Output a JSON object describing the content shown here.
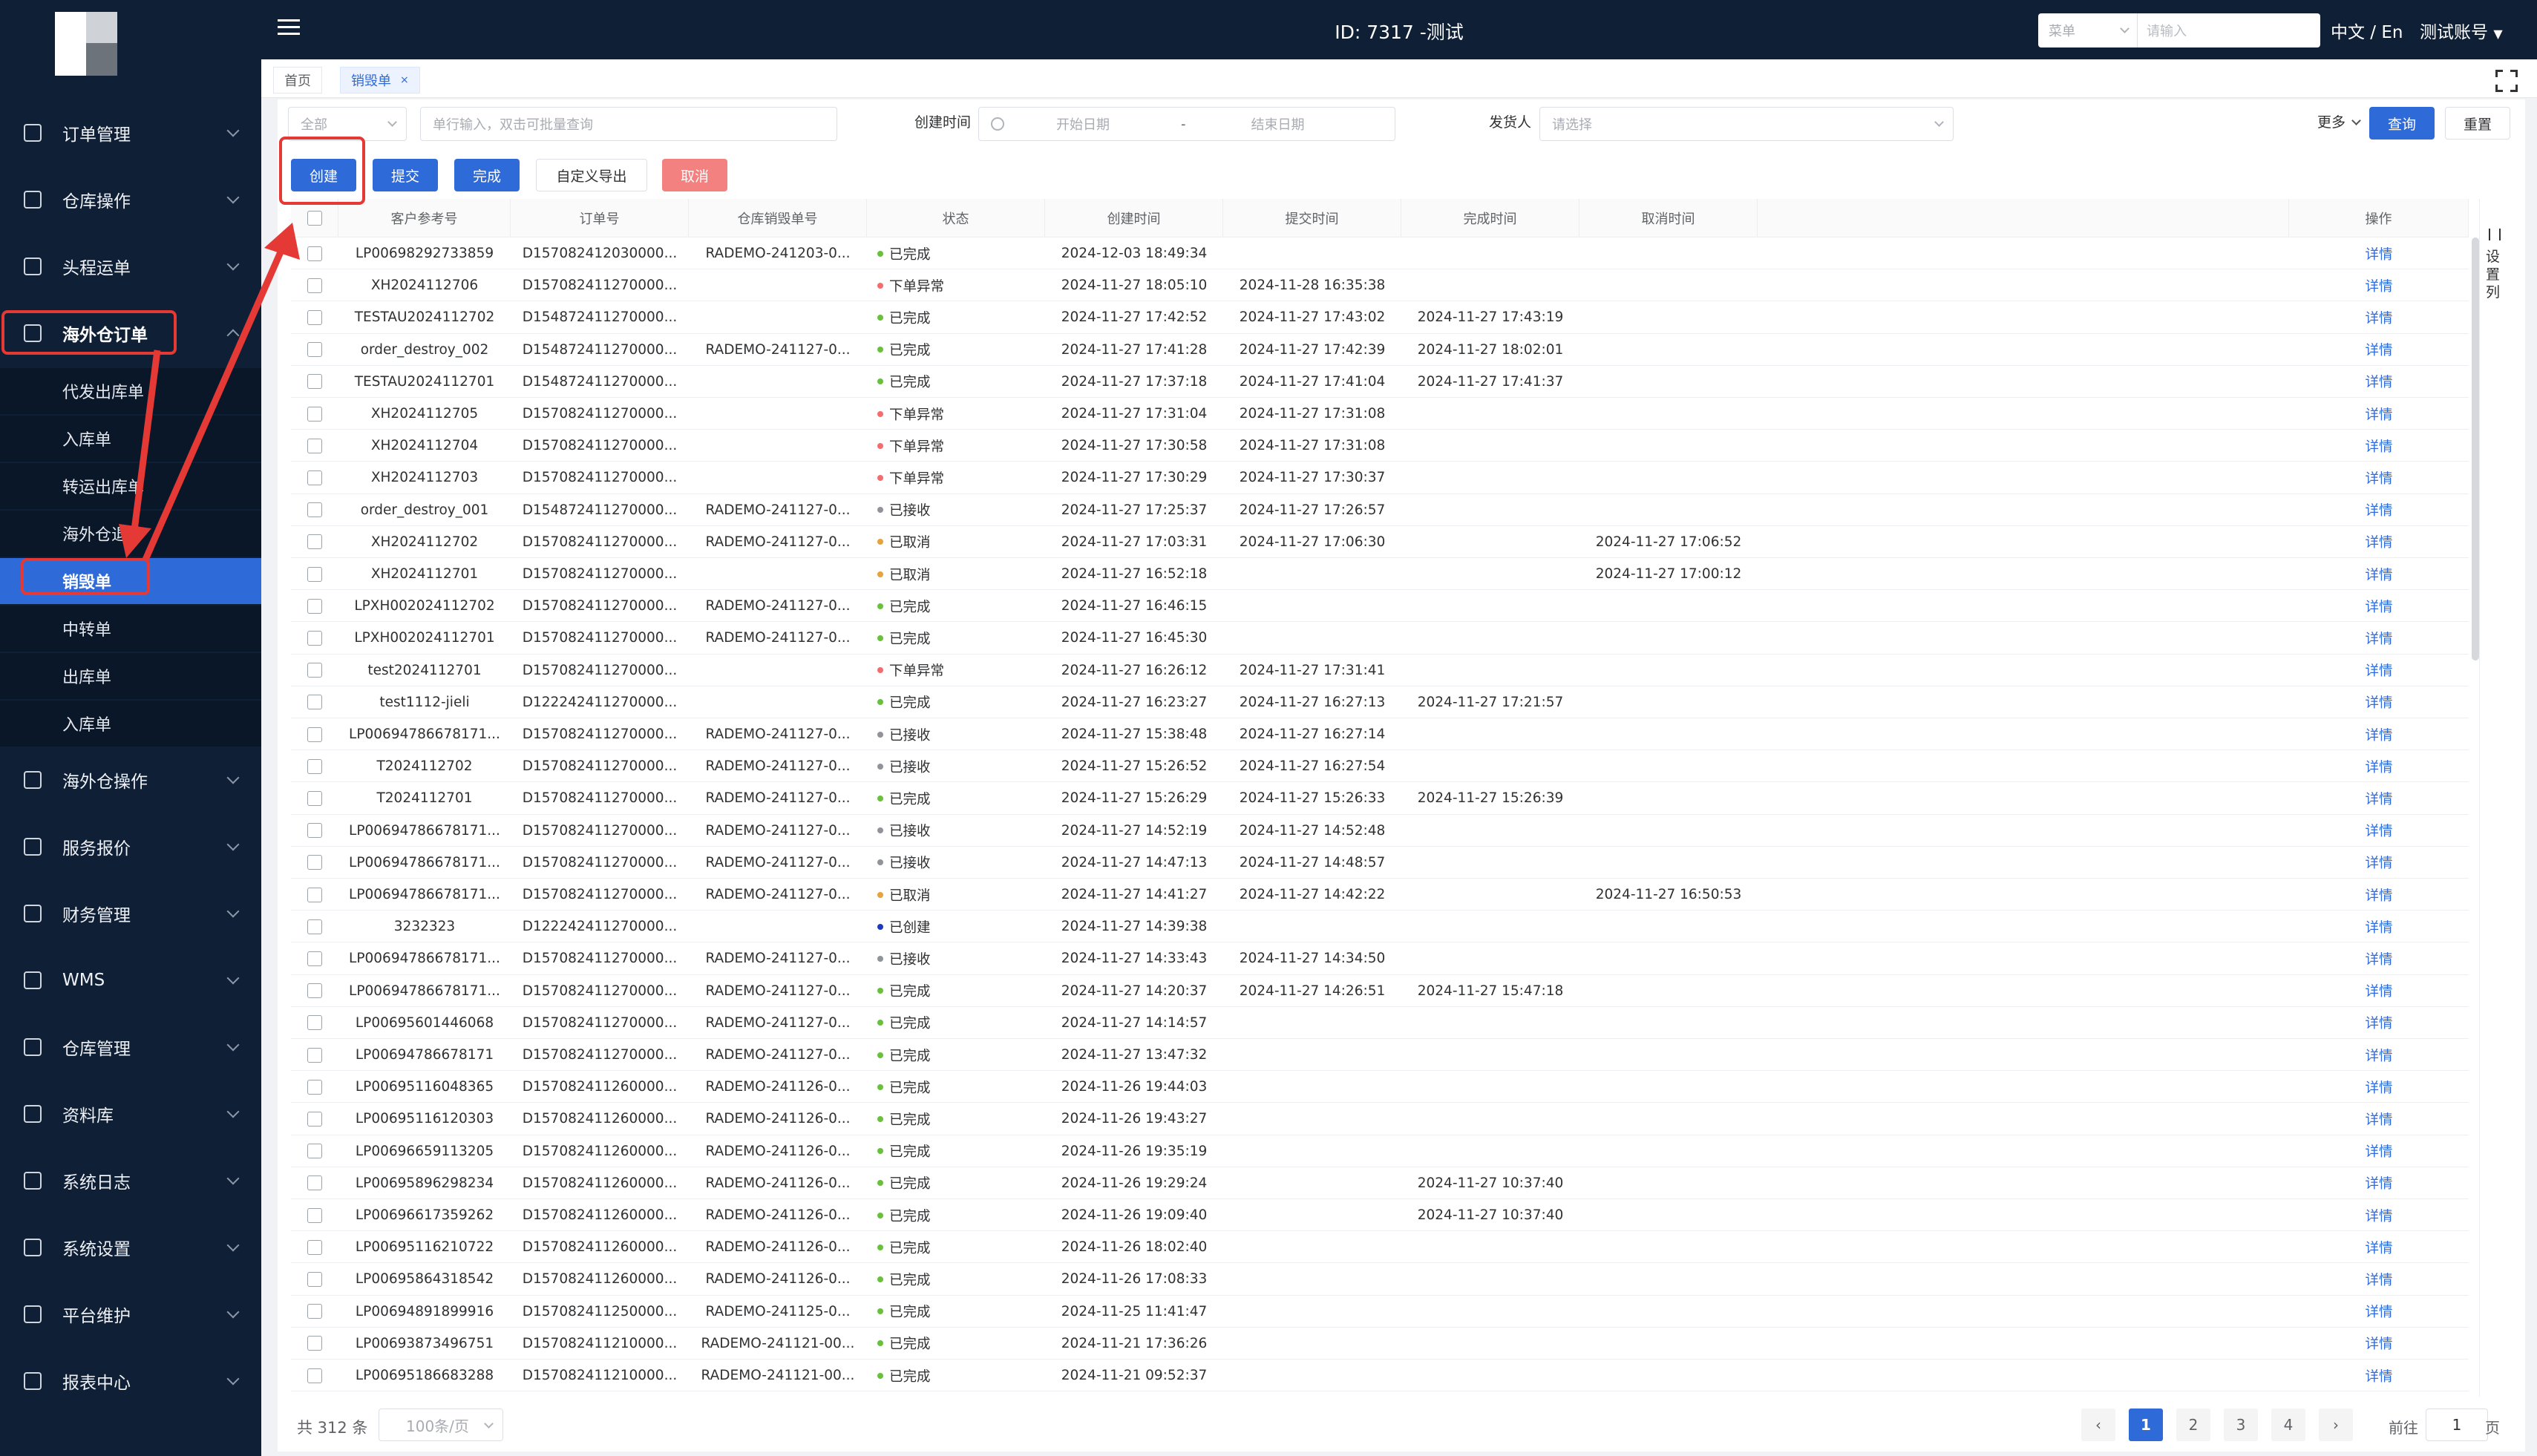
{
  "header": {
    "title": "ID: 7317 -测试",
    "search_select": "菜单",
    "search_placeholder": "请输入",
    "lang": "中文 / En",
    "account": "测试账号"
  },
  "sidebar": {
    "menus": [
      {
        "label": "订单管理",
        "icon": "order-icon"
      },
      {
        "label": "仓库操作",
        "icon": "warehouse-ops-icon"
      },
      {
        "label": "头程运单",
        "icon": "shipment-icon"
      },
      {
        "label": "海外仓订单",
        "icon": "overseas-order-icon"
      },
      {
        "label": "海外仓操作",
        "icon": "overseas-ops-icon"
      },
      {
        "label": "服务报价",
        "icon": "quote-icon"
      },
      {
        "label": "财务管理",
        "icon": "finance-icon"
      },
      {
        "label": "WMS",
        "icon": "wms-icon"
      },
      {
        "label": "仓库管理",
        "icon": "warehouse-icon"
      },
      {
        "label": "资料库",
        "icon": "database-icon"
      },
      {
        "label": "系统日志",
        "icon": "log-icon"
      },
      {
        "label": "系统设置",
        "icon": "settings-icon"
      },
      {
        "label": "平台维护",
        "icon": "platform-icon"
      },
      {
        "label": "报表中心",
        "icon": "report-icon"
      }
    ],
    "sub_items": [
      "代发出库单",
      "入库单",
      "转运出库单",
      "海外仓退件",
      "销毁单",
      "中转单",
      "出库单",
      "入库单"
    ]
  },
  "tabs": [
    {
      "label": "首页"
    },
    {
      "label": "销毁单",
      "close": "×"
    }
  ],
  "filters": {
    "scope_value": "全部",
    "batch_placeholder": "单行输入，双击可批量查询",
    "created_label": "创建时间",
    "start_placeholder": "开始日期",
    "range_sep": "-",
    "end_placeholder": "结束日期",
    "sender_label": "发货人",
    "sender_placeholder": "请选择",
    "more": "更多",
    "query": "查询",
    "reset": "重置"
  },
  "actions": {
    "create": "创建",
    "submit": "提交",
    "complete": "完成",
    "export": "自定义导出",
    "cancel": "取消"
  },
  "table": {
    "headers": [
      "客户参考号",
      "订单号",
      "仓库销毁单号",
      "状态",
      "创建时间",
      "提交时间",
      "完成时间",
      "取消时间",
      "操作"
    ],
    "settings_label": "设置列",
    "detail": "详情",
    "rows": [
      [
        "LP00698292733859",
        "D157082412030000...",
        "RADEMO-241203-0...",
        "已完成",
        "2024-12-03 18:49:34",
        "",
        "",
        ""
      ],
      [
        "XH2024112706",
        "D157082411270000...",
        "",
        "下单异常",
        "2024-11-27 18:05:10",
        "2024-11-28 16:35:38",
        "",
        ""
      ],
      [
        "TESTAU2024112702",
        "D154872411270000...",
        "",
        "已完成",
        "2024-11-27 17:42:52",
        "2024-11-27 17:43:02",
        "2024-11-27 17:43:19",
        ""
      ],
      [
        "order_destroy_002",
        "D154872411270000...",
        "RADEMO-241127-0...",
        "已完成",
        "2024-11-27 17:41:28",
        "2024-11-27 17:42:39",
        "2024-11-27 18:02:01",
        ""
      ],
      [
        "TESTAU2024112701",
        "D154872411270000...",
        "",
        "已完成",
        "2024-11-27 17:37:18",
        "2024-11-27 17:41:04",
        "2024-11-27 17:41:37",
        ""
      ],
      [
        "XH2024112705",
        "D157082411270000...",
        "",
        "下单异常",
        "2024-11-27 17:31:04",
        "2024-11-27 17:31:08",
        "",
        ""
      ],
      [
        "XH2024112704",
        "D157082411270000...",
        "",
        "下单异常",
        "2024-11-27 17:30:58",
        "2024-11-27 17:31:08",
        "",
        ""
      ],
      [
        "XH2024112703",
        "D157082411270000...",
        "",
        "下单异常",
        "2024-11-27 17:30:29",
        "2024-11-27 17:30:37",
        "",
        ""
      ],
      [
        "order_destroy_001",
        "D154872411270000...",
        "RADEMO-241127-0...",
        "已接收",
        "2024-11-27 17:25:37",
        "2024-11-27 17:26:57",
        "",
        ""
      ],
      [
        "XH2024112702",
        "D157082411270000...",
        "RADEMO-241127-0...",
        "已取消",
        "2024-11-27 17:03:31",
        "2024-11-27 17:06:30",
        "",
        "2024-11-27 17:06:52"
      ],
      [
        "XH2024112701",
        "D157082411270000...",
        "",
        "已取消",
        "2024-11-27 16:52:18",
        "",
        "",
        "2024-11-27 17:00:12"
      ],
      [
        "LPXH002024112702",
        "D157082411270000...",
        "RADEMO-241127-0...",
        "已完成",
        "2024-11-27 16:46:15",
        "",
        "",
        ""
      ],
      [
        "LPXH002024112701",
        "D157082411270000...",
        "RADEMO-241127-0...",
        "已完成",
        "2024-11-27 16:45:30",
        "",
        "",
        ""
      ],
      [
        "test2024112701",
        "D157082411270000...",
        "",
        "下单异常",
        "2024-11-27 16:26:12",
        "2024-11-27 17:31:41",
        "",
        ""
      ],
      [
        "test1112-jieli",
        "D122242411270000...",
        "",
        "已完成",
        "2024-11-27 16:23:27",
        "2024-11-27 16:27:13",
        "2024-11-27 17:21:57",
        ""
      ],
      [
        "LP00694786678171...",
        "D157082411270000...",
        "RADEMO-241127-0...",
        "已接收",
        "2024-11-27 15:38:48",
        "2024-11-27 16:27:14",
        "",
        ""
      ],
      [
        "T2024112702",
        "D157082411270000...",
        "RADEMO-241127-0...",
        "已接收",
        "2024-11-27 15:26:52",
        "2024-11-27 16:27:54",
        "",
        ""
      ],
      [
        "T2024112701",
        "D157082411270000...",
        "RADEMO-241127-0...",
        "已完成",
        "2024-11-27 15:26:29",
        "2024-11-27 15:26:33",
        "2024-11-27 15:26:39",
        ""
      ],
      [
        "LP00694786678171...",
        "D157082411270000...",
        "RADEMO-241127-0...",
        "已接收",
        "2024-11-27 14:52:19",
        "2024-11-27 14:52:48",
        "",
        ""
      ],
      [
        "LP00694786678171...",
        "D157082411270000...",
        "RADEMO-241127-0...",
        "已接收",
        "2024-11-27 14:47:13",
        "2024-11-27 14:48:57",
        "",
        ""
      ],
      [
        "LP00694786678171...",
        "D157082411270000...",
        "RADEMO-241127-0...",
        "已取消",
        "2024-11-27 14:41:27",
        "2024-11-27 14:42:22",
        "",
        "2024-11-27 16:50:53"
      ],
      [
        "3232323",
        "D122242411270000...",
        "",
        "已创建",
        "2024-11-27 14:39:38",
        "",
        "",
        ""
      ],
      [
        "LP00694786678171...",
        "D157082411270000...",
        "RADEMO-241127-0...",
        "已接收",
        "2024-11-27 14:33:43",
        "2024-11-27 14:34:50",
        "",
        ""
      ],
      [
        "LP00694786678171...",
        "D157082411270000...",
        "RADEMO-241127-0...",
        "已完成",
        "2024-11-27 14:20:37",
        "2024-11-27 14:26:51",
        "2024-11-27 15:47:18",
        ""
      ],
      [
        "LP00695601446068",
        "D157082411270000...",
        "RADEMO-241127-0...",
        "已完成",
        "2024-11-27 14:14:57",
        "",
        "",
        ""
      ],
      [
        "LP00694786678171",
        "D157082411270000...",
        "RADEMO-241127-0...",
        "已完成",
        "2024-11-27 13:47:32",
        "",
        "",
        ""
      ],
      [
        "LP00695116048365",
        "D157082411260000...",
        "RADEMO-241126-0...",
        "已完成",
        "2024-11-26 19:44:03",
        "",
        "",
        ""
      ],
      [
        "LP00695116120303",
        "D157082411260000...",
        "RADEMO-241126-0...",
        "已完成",
        "2024-11-26 19:43:27",
        "",
        "",
        ""
      ],
      [
        "LP00696659113205",
        "D157082411260000...",
        "RADEMO-241126-0...",
        "已完成",
        "2024-11-26 19:35:19",
        "",
        "",
        ""
      ],
      [
        "LP00695896298234",
        "D157082411260000...",
        "RADEMO-241126-0...",
        "已完成",
        "2024-11-26 19:29:24",
        "",
        "2024-11-27 10:37:40",
        ""
      ],
      [
        "LP00696617359262",
        "D157082411260000...",
        "RADEMO-241126-0...",
        "已完成",
        "2024-11-26 19:09:40",
        "",
        "2024-11-27 10:37:40",
        ""
      ],
      [
        "LP00695116210722",
        "D157082411260000...",
        "RADEMO-241126-0...",
        "已完成",
        "2024-11-26 18:02:40",
        "",
        "",
        ""
      ],
      [
        "LP00695864318542",
        "D157082411260000...",
        "RADEMO-241126-0...",
        "已完成",
        "2024-11-26 17:08:33",
        "",
        "",
        ""
      ],
      [
        "LP00694891899916",
        "D157082411250000...",
        "RADEMO-241125-0...",
        "已完成",
        "2024-11-25 11:41:47",
        "",
        "",
        ""
      ],
      [
        "LP00693873496751",
        "D157082411210000...",
        "RADEMO-241121-00...",
        "已完成",
        "2024-11-21 17:36:26",
        "",
        "",
        ""
      ],
      [
        "LP00695186683288",
        "D157082411210000...",
        "RADEMO-241121-00...",
        "已完成",
        "2024-11-21 09:52:37",
        "",
        "",
        ""
      ]
    ]
  },
  "status_colors": {
    "已完成": "#67c23a",
    "下单异常": "#f56c6c",
    "已接收": "#909399",
    "已取消": "#e6a23c",
    "已创建": "#1d39c4"
  },
  "pagination": {
    "total": "共 312 条",
    "page_size": "100条/页",
    "pages": [
      "1",
      "2",
      "3",
      "4"
    ],
    "prev": "‹",
    "next": "›",
    "goto_label": "前往",
    "goto_value": "1",
    "page_unit": "页"
  },
  "colors": {
    "primary": "#2f6bd8",
    "sidebar_bg": "#0f1f36",
    "annotation": "#e53935"
  }
}
